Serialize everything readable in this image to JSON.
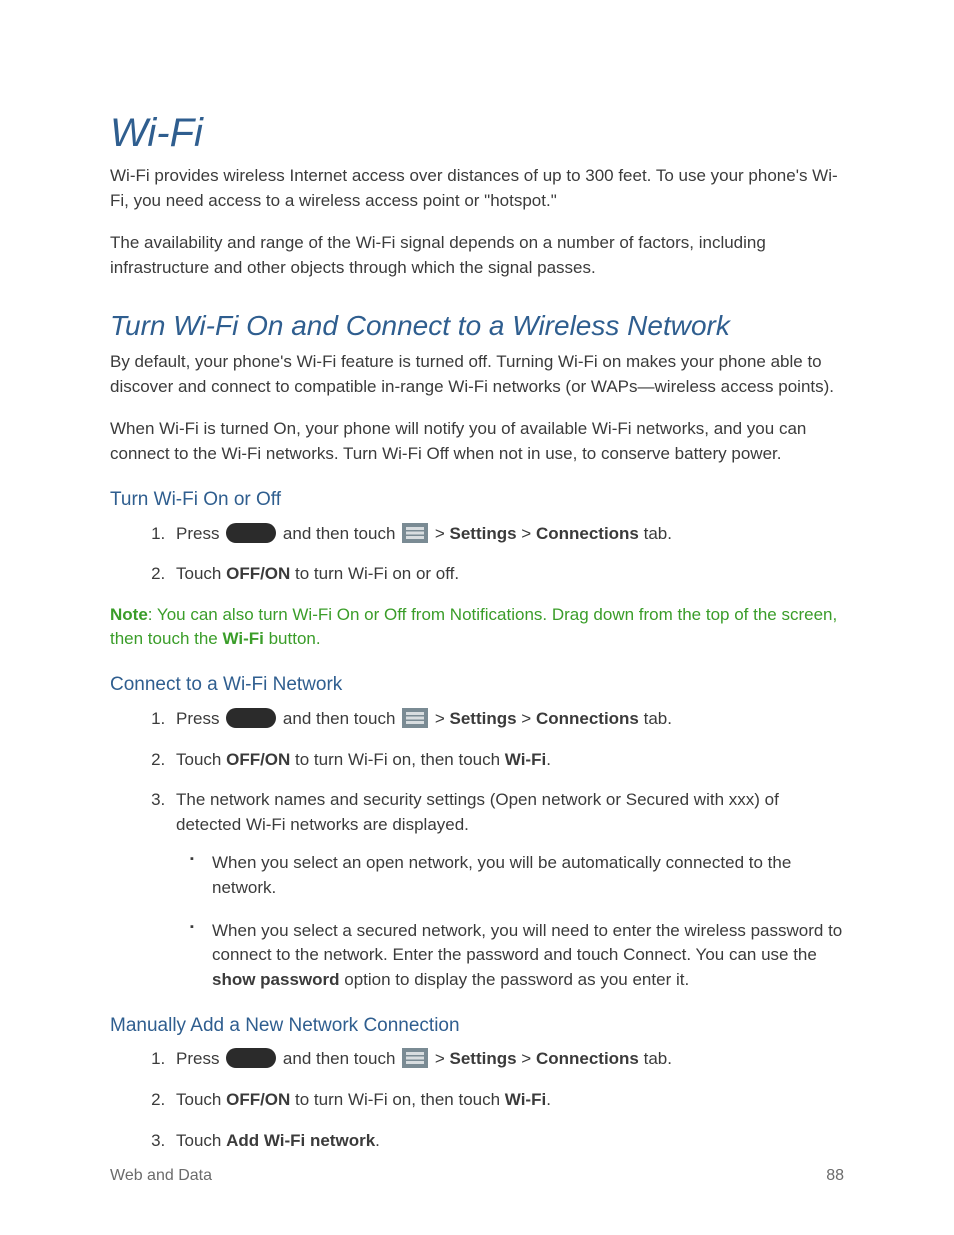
{
  "title": "Wi-Fi",
  "intro1": "Wi-Fi provides wireless Internet access over distances of up to 300 feet. To use your phone's Wi-Fi, you need access to a wireless access point or \"hotspot.\"",
  "intro2": "The availability and range of the Wi-Fi signal depends on a number of factors, including infrastructure and other objects through which the signal passes.",
  "section1": {
    "title": "Turn Wi-Fi On and Connect to a Wireless Network",
    "p1": "By default, your phone's Wi-Fi feature is turned off. Turning Wi-Fi on makes your phone able to discover and connect to compatible in-range Wi-Fi networks (or WAPs—wireless access points).",
    "p2": "When Wi-Fi is turned On, your phone will notify you of available Wi-Fi networks, and you can connect to the Wi-Fi networks. Turn Wi-Fi Off when not in use, to conserve battery power."
  },
  "sub_a": {
    "title": "Turn Wi-Fi On or Off",
    "step1": {
      "pre": "Press ",
      "mid": " and then touch ",
      "gt": " > ",
      "settings": "Settings",
      "connections": "Connections",
      "tab": " tab."
    },
    "step2": {
      "pre": "Touch ",
      "offon": "OFF/ON",
      "post": " to turn Wi-Fi on or off."
    }
  },
  "note": {
    "label": "Note",
    "sep": ": ",
    "t1": "You can also turn Wi-Fi On or Off from Notifications. Drag down from the top of the screen, then touch the ",
    "wifi": "Wi-Fi",
    "t2": " button."
  },
  "sub_b": {
    "title": "Connect to a Wi-Fi Network",
    "step1": {
      "pre": "Press ",
      "mid": " and then touch ",
      "gt": " > ",
      "settings": "Settings",
      "connections": "Connections",
      "tab": " tab."
    },
    "step2": {
      "pre": "Touch ",
      "offon": "OFF/ON",
      "mid": " to turn Wi-Fi on, then touch ",
      "wifi": "Wi-Fi",
      "post": "."
    },
    "step3": {
      "t": "The network names and security settings (Open network or Secured with xxx) of detected Wi-Fi networks are displayed."
    },
    "bullet1": "When you select an open network, you will be automatically connected to the network.",
    "bullet2": {
      "t1": "When you select a secured network, you will need to enter the wireless password to connect to the network. Enter the password and touch Connect. You can use the ",
      "sp": "show password",
      "t2": " option to display the password as you enter it."
    }
  },
  "sub_c": {
    "title": "Manually Add a New Network Connection",
    "step1": {
      "pre": "Press ",
      "mid": " and then touch ",
      "gt": " > ",
      "settings": "Settings",
      "connections": "Connections",
      "tab": " tab."
    },
    "step2": {
      "pre": "Touch ",
      "offon": "OFF/ON",
      "mid": " to turn Wi-Fi on, then touch ",
      "wifi": "Wi-Fi",
      "post": "."
    },
    "step3": {
      "pre": "Touch ",
      "add": "Add Wi-Fi network",
      "post": "."
    }
  },
  "footer": {
    "left": "Web and Data",
    "right": "88"
  }
}
